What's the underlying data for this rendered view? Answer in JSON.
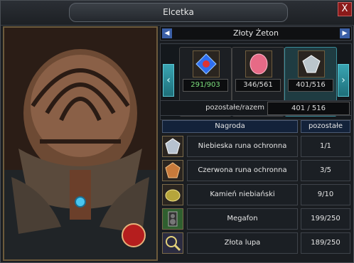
{
  "window": {
    "title": "Elcetka",
    "close_label": "X"
  },
  "token_selector": {
    "label": "Złoty Żeton",
    "prev_icon": "left-triangle-icon",
    "next_icon": "right-triangle-icon"
  },
  "carousel": {
    "slots": [
      {
        "icon": "blue-gem-icon",
        "count": "291/903",
        "highlight": "green"
      },
      {
        "icon": "red-gem-icon",
        "count": "346/561",
        "highlight": "none"
      },
      {
        "icon": "diamond-icon",
        "count": "401/516",
        "highlight": "active"
      }
    ]
  },
  "summary": {
    "label": "pozostałe/razem",
    "value": "401 / 516"
  },
  "table": {
    "headers": [
      "Nagroda",
      "pozostałe"
    ],
    "rows": [
      {
        "icon": "blue-rune-icon",
        "name": "Niebieska runa ochronna",
        "count": "1/1"
      },
      {
        "icon": "red-rune-icon",
        "name": "Czerwona runa ochronna",
        "count": "3/5"
      },
      {
        "icon": "celestial-stone-icon",
        "name": "Kamień niebiański",
        "count": "9/10"
      },
      {
        "icon": "megaphone-icon",
        "name": "Megafon",
        "count": "199/250"
      },
      {
        "icon": "golden-magnifier-icon",
        "name": "Złota lupa",
        "count": "189/250"
      }
    ]
  }
}
